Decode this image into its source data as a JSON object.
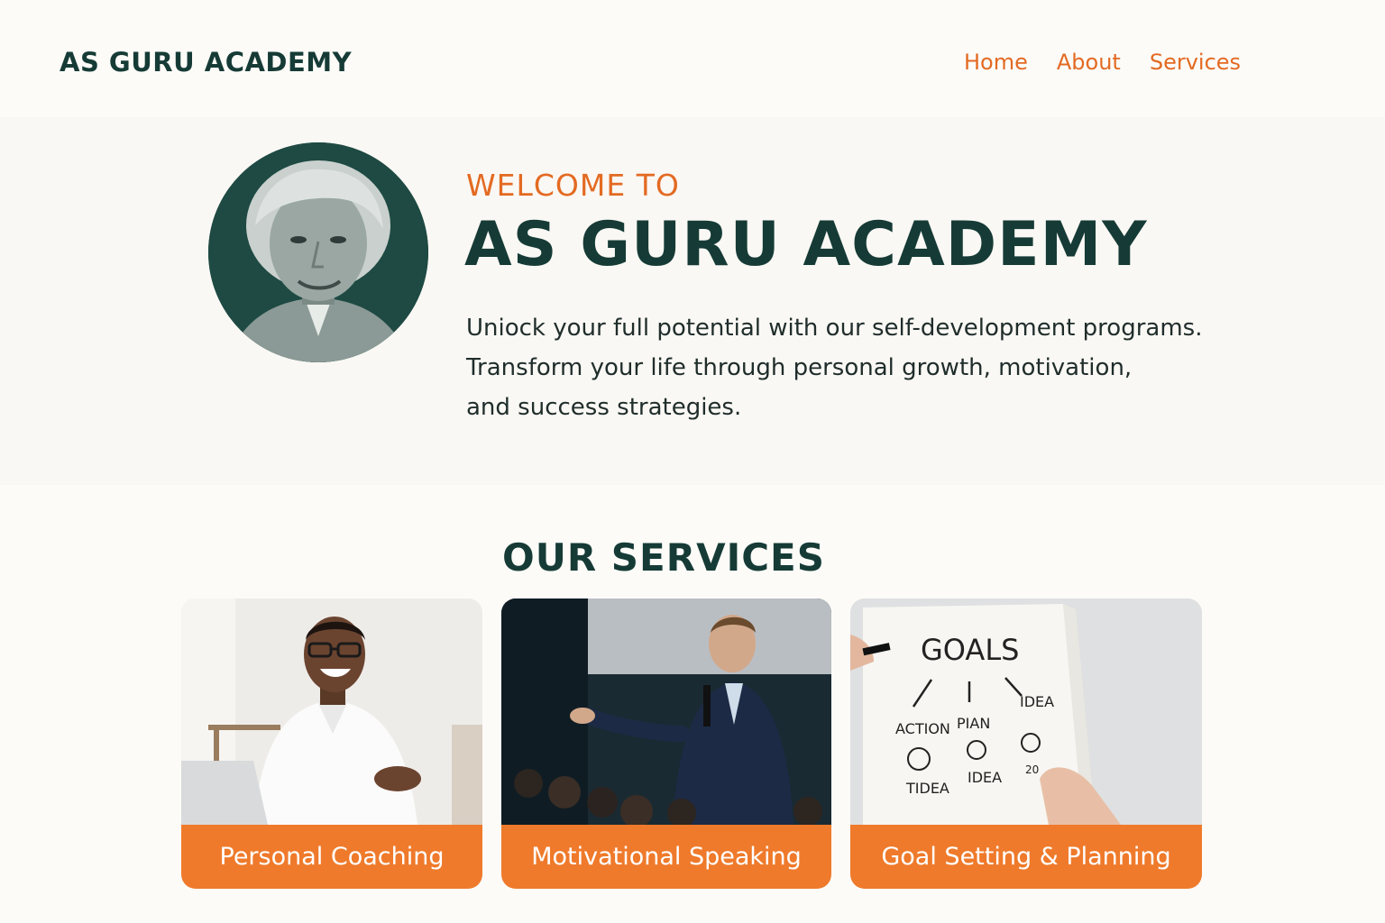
{
  "header": {
    "logo": "AS GURU ACADEMY",
    "nav": [
      "Home",
      "About",
      "Services"
    ]
  },
  "hero": {
    "welcome": "WELCOME TO",
    "title": "AS GURU ACADEMY",
    "description_lines": [
      "Uniock your full potential with our self-development programs.",
      "Transform your life through personal growth, motivation,",
      "and success strategies."
    ]
  },
  "services": {
    "title": "OUR SERVICES",
    "cards": [
      {
        "label": "Personal Coaching"
      },
      {
        "label": "Motivational Speaking"
      },
      {
        "label": "Goal Setting & Planning",
        "image_text": {
          "heading": "GOALS",
          "words": [
            "ACTION",
            "PIAN",
            "IDEA",
            "IDEA",
            "TIDEA",
            "20"
          ]
        }
      }
    ]
  },
  "colors": {
    "accent": "#e36a22",
    "card_label_bg": "#ef7a2b",
    "dark": "#163b36",
    "background": "#fcfbf8"
  }
}
